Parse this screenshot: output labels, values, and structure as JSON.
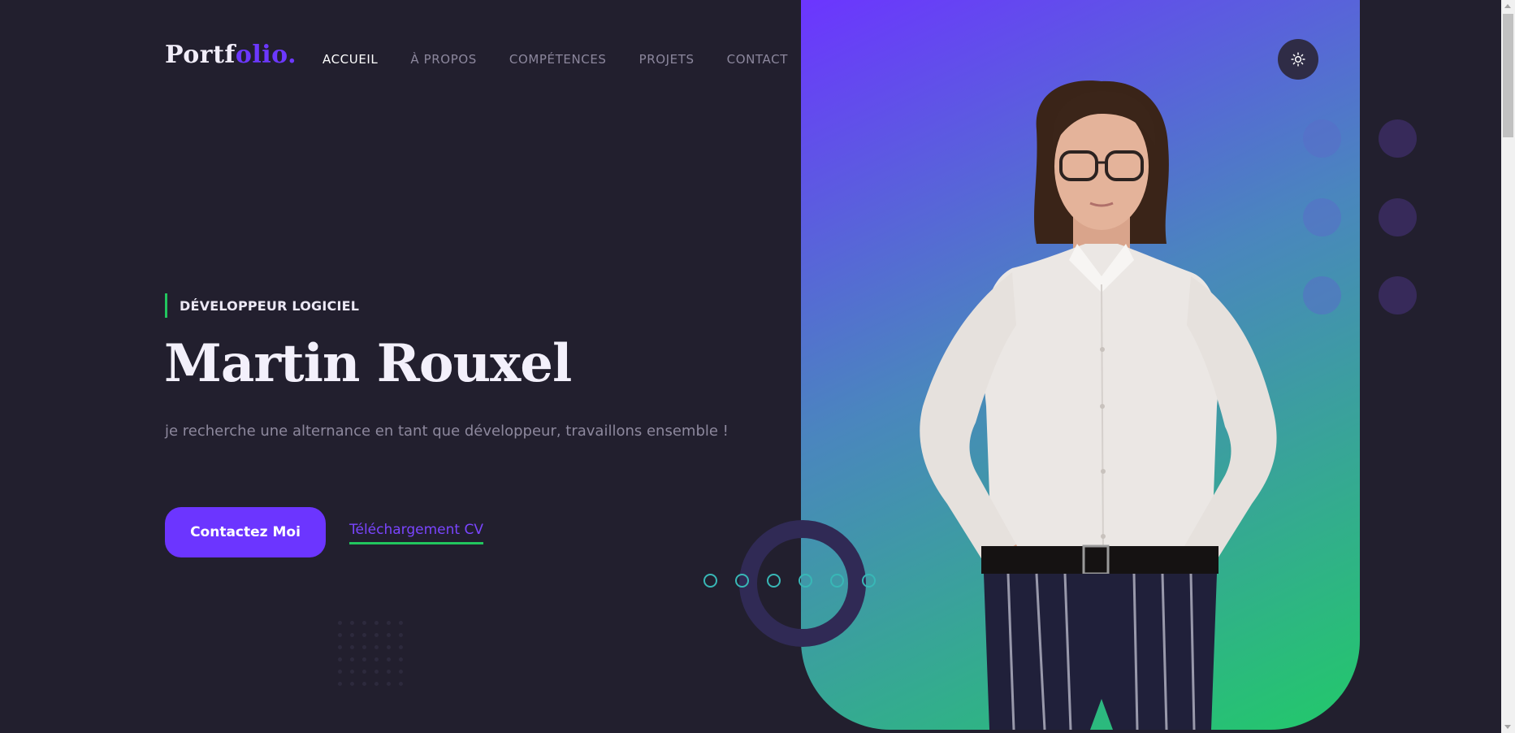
{
  "logo": {
    "main": "Portf",
    "accent": "olio."
  },
  "nav": {
    "items": [
      {
        "label": "ACCUEIL",
        "active": true
      },
      {
        "label": "À PROPOS",
        "active": false
      },
      {
        "label": "COMPÉTENCES",
        "active": false
      },
      {
        "label": "PROJETS",
        "active": false
      },
      {
        "label": "CONTACT",
        "active": false
      }
    ]
  },
  "theme_toggle": {
    "icon": "sun-icon"
  },
  "hero": {
    "subtitle": "DÉVELOPPEUR LOGICIEL",
    "name": "Martin Rouxel",
    "tagline": "je recherche une alternance en tant que développeur, travaillons ensemble !",
    "primary_button": "Contactez Moi",
    "secondary_link": "Téléchargement CV",
    "portrait": "portrait-photo"
  },
  "colors": {
    "background": "#221f2e",
    "accent_purple": "#6c35ff",
    "accent_green": "#22c55e",
    "gradient_start": "#6c35ff",
    "gradient_end": "#22c96a"
  }
}
